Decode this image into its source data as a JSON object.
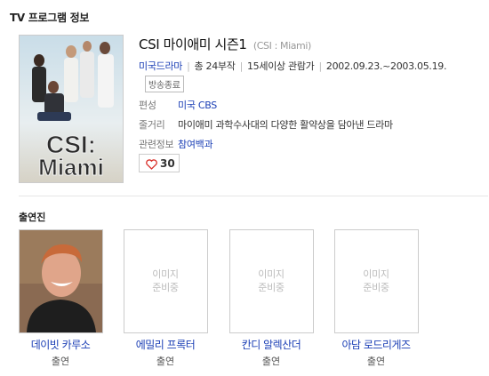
{
  "section": {
    "title": "TV 프로그램 정보"
  },
  "poster": {
    "logo_line1": "CSI:",
    "logo_line2": "Miami"
  },
  "program": {
    "title": "CSI 마이애미 시즌1",
    "subtitle": "(CSI : Miami)",
    "genre": "미국드라마",
    "episodes": "총 24부작",
    "rating": "15세이상 관람가",
    "period": "2002.09.23.~2003.05.19.",
    "status_badge": "방송종료",
    "channel_label": "편성",
    "channel_value": "미국 CBS",
    "plot_label": "줄거리",
    "plot_value": "마이애미 과학수사대의 다양한 활약상을 담아낸 드라마",
    "related_label": "관련정보",
    "related_value": "참여백과",
    "like_count": "30"
  },
  "cast": {
    "title": "출연진",
    "placeholder_line1": "이미지",
    "placeholder_line2": "준비중",
    "members": [
      {
        "name": "데이빗 카루소",
        "role": "출연"
      },
      {
        "name": "에밀리 프록터",
        "role": "출연"
      },
      {
        "name": "칸디 알렉산더",
        "role": "출연"
      },
      {
        "name": "아담 로드리게즈",
        "role": "출연"
      }
    ]
  },
  "colors": {
    "link": "#1a3eb5",
    "heart": "#d9302a"
  }
}
